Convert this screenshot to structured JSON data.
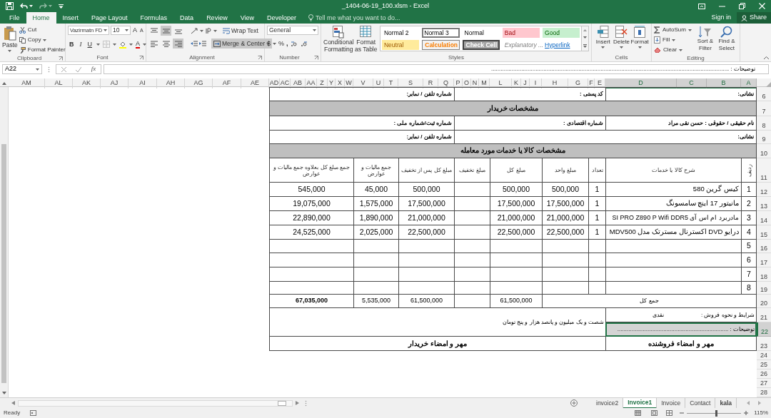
{
  "window": {
    "title": "_1404-06-19_100.xlsm - Excel"
  },
  "ribbon_tabs": [
    {
      "label": "File",
      "selected": false
    },
    {
      "label": "Home",
      "selected": true
    },
    {
      "label": "Insert",
      "selected": false
    },
    {
      "label": "Page Layout",
      "selected": false
    },
    {
      "label": "Formulas",
      "selected": false
    },
    {
      "label": "Data",
      "selected": false
    },
    {
      "label": "Review",
      "selected": false
    },
    {
      "label": "View",
      "selected": false
    },
    {
      "label": "Developer",
      "selected": false
    }
  ],
  "tell_me": {
    "placeholder": "Tell me what you want to do..."
  },
  "account": {
    "sign_in": "Sign in",
    "share": "Share"
  },
  "clipboard": {
    "paste": "Paste",
    "cut": "Cut",
    "copy": "Copy",
    "format_painter": "Format Painter",
    "label": "Clipboard"
  },
  "font": {
    "name": "Vazirmatn FD",
    "size": "10",
    "grow": "A",
    "shrink": "A",
    "bold": "B",
    "italic": "I",
    "underline": "U",
    "font_color": "A",
    "label": "Font"
  },
  "alignment": {
    "vertical": [
      {
        "selected": false
      },
      {
        "selected": true
      },
      {
        "selected": false
      }
    ],
    "horizontal": [
      {
        "selected": false
      },
      {
        "selected": false
      },
      {
        "selected": true
      }
    ],
    "wrap_text": "Wrap Text",
    "merge_center": {
      "label": "Merge & Center",
      "selected": true
    },
    "label": "Alignment"
  },
  "number": {
    "format": "General",
    "currency": "$",
    "percent": "%",
    "comma": ",",
    "label": "Number"
  },
  "styles": {
    "conditional_formatting": "Conditional Formatting",
    "format_as_table": "Format as Table",
    "gallery": [
      {
        "label": "Normal 2",
        "kind": "normal",
        "selected": false
      },
      {
        "label": "Normal 3",
        "kind": "normal",
        "selected": true
      },
      {
        "label": "Normal",
        "kind": "normal",
        "selected": false
      },
      {
        "label": "Bad",
        "kind": "bad",
        "selected": false
      },
      {
        "label": "Good",
        "kind": "good",
        "selected": false
      },
      {
        "label": "Neutral",
        "kind": "neutral",
        "selected": false
      },
      {
        "label": "Calculation",
        "kind": "calculation",
        "selected": false
      },
      {
        "label": "Check Cell",
        "kind": "check",
        "selected": false
      },
      {
        "label": "Explanatory ...",
        "kind": "explanatory",
        "selected": false
      },
      {
        "label": "Hyperlink",
        "kind": "hyperlink",
        "selected": false
      }
    ],
    "label": "Styles"
  },
  "cells": {
    "insert": "Insert",
    "delete": "Delete",
    "format": "Format",
    "label": "Cells"
  },
  "editing": {
    "autosum": "AutoSum",
    "fill": "Fill",
    "clear": "Clear",
    "sort_filter": "Sort & Filter",
    "find_select": "Find & Select",
    "label": "Editing"
  },
  "formula_bar": {
    "name_box": "A22",
    "function_label": "fx",
    "content": "توضیحات : ......................................................................................................................................................"
  },
  "sheet": {
    "columns": [
      {
        "label": "AM",
        "selected": false
      },
      {
        "label": "AL",
        "selected": false
      },
      {
        "label": "AK",
        "selected": false
      },
      {
        "label": "AJ",
        "selected": false
      },
      {
        "label": "AI",
        "selected": false
      },
      {
        "label": "AH",
        "selected": false
      },
      {
        "label": "AG",
        "selected": false
      },
      {
        "label": "AF",
        "selected": false
      },
      {
        "label": "AE",
        "selected": false
      },
      {
        "label": "AD",
        "selected": false
      },
      {
        "label": "AC",
        "selected": false
      },
      {
        "label": "AB",
        "selected": false
      },
      {
        "label": "AA",
        "selected": false
      },
      {
        "label": "Z",
        "selected": false
      },
      {
        "label": "Y",
        "selected": false
      },
      {
        "label": "X",
        "selected": false
      },
      {
        "label": "W",
        "selected": false
      },
      {
        "label": "V",
        "selected": false
      },
      {
        "label": "U",
        "selected": false
      },
      {
        "label": "T",
        "selected": false
      },
      {
        "label": "S",
        "selected": false
      },
      {
        "label": "R",
        "selected": false
      },
      {
        "label": "Q",
        "selected": false
      },
      {
        "label": "P",
        "selected": false
      },
      {
        "label": "O",
        "selected": false
      },
      {
        "label": "N",
        "selected": false
      },
      {
        "label": "M",
        "selected": false
      },
      {
        "label": "L",
        "selected": false
      },
      {
        "label": "K",
        "selected": false
      },
      {
        "label": "J",
        "selected": false
      },
      {
        "label": "I",
        "selected": false
      },
      {
        "label": "H",
        "selected": false
      },
      {
        "label": "G",
        "selected": false
      },
      {
        "label": "F",
        "selected": false
      },
      {
        "label": "E",
        "selected": false
      },
      {
        "label": "D",
        "selected": true
      },
      {
        "label": "C",
        "selected": true
      },
      {
        "label": "B",
        "selected": true
      },
      {
        "label": "A",
        "selected": true
      }
    ],
    "rows": [
      {
        "label": "6",
        "selected": false
      },
      {
        "label": "7",
        "selected": false
      },
      {
        "label": "8",
        "selected": false
      },
      {
        "label": "9",
        "selected": false
      },
      {
        "label": "10",
        "selected": false
      },
      {
        "label": "11",
        "selected": false
      },
      {
        "label": "12",
        "selected": false
      },
      {
        "label": "13",
        "selected": false
      },
      {
        "label": "14",
        "selected": false
      },
      {
        "label": "15",
        "selected": false
      },
      {
        "label": "16",
        "selected": false
      },
      {
        "label": "17",
        "selected": false
      },
      {
        "label": "18",
        "selected": false
      },
      {
        "label": "19",
        "selected": false
      },
      {
        "label": "20",
        "selected": false
      },
      {
        "label": "21",
        "selected": false
      },
      {
        "label": "22",
        "selected": true
      },
      {
        "label": "23",
        "selected": false
      },
      {
        "label": "24",
        "selected": false
      },
      {
        "label": "25",
        "selected": false
      },
      {
        "label": "26",
        "selected": false
      },
      {
        "label": "27",
        "selected": false
      },
      {
        "label": "28",
        "selected": false
      }
    ],
    "seller": {
      "address": "نشانی:",
      "postal_code": "کد پستی :",
      "phone": "شماره تلفن / نمابر:"
    },
    "buyer_heading": "مشخصات خریدار",
    "buyer": {
      "name": "نام حقیقی / حقوقی : حسن نقی مراد",
      "economic_code": "شماره اقتصادی :",
      "registration": "شماره ثبت/شماره ملی :",
      "address": "نشانی:",
      "phone": "شماره تلفن / نمابر:"
    },
    "items_heading": "مشخصات کالا یا خدمات مورد معامله",
    "item_columns": [
      "ردیف",
      "شرح کالا یا خدمات",
      "تعداد",
      "مبلغ واحد",
      "مبلغ کل",
      "مبلغ تخفیف",
      "مبلغ کل پس از تخفیف",
      "جمع مالیات و عوارض",
      "جمع مبلغ کل بعلاوه جمع مالیات و عوارض"
    ],
    "items": [
      {
        "index": "1",
        "description": "کیس گرین 580",
        "quantity": "1",
        "unit_price": "500,000",
        "total": "500,000",
        "total_after_discount": "500,000",
        "tax": "45,000",
        "grand_total": "545,000"
      },
      {
        "index": "2",
        "description": "مانیتور 17 اینچ سامسونگ",
        "quantity": "1",
        "unit_price": "17,500,000",
        "total": "17,500,000",
        "total_after_discount": "17,500,000",
        "tax": "1,575,000",
        "grand_total": "19,075,000"
      },
      {
        "index": "3",
        "description": "مادربرد ام اس آی SI PRO Z890 P Wifi DDR5",
        "quantity": "1",
        "unit_price": "21,000,000",
        "total": "21,000,000",
        "total_after_discount": "21,000,000",
        "tax": "1,890,000",
        "grand_total": "22,890,000"
      },
      {
        "index": "4",
        "description": "درایو DVD اکسترنال مسترتک مدل MDV500",
        "quantity": "1",
        "unit_price": "22,500,000",
        "total": "22,500,000",
        "total_after_discount": "22,500,000",
        "tax": "2,025,000",
        "grand_total": "24,525,000"
      },
      {
        "index": "5"
      },
      {
        "index": "6"
      },
      {
        "index": "7"
      },
      {
        "index": "8"
      }
    ],
    "totals": {
      "label": "جمع کل",
      "total": "61,500,000",
      "total_after_discount": "61,500,000",
      "tax": "5,535,000",
      "grand_total": "67,035,000"
    },
    "terms": {
      "label": "شرایط و نحوه فروش :",
      "value": "نقدی"
    },
    "amount_in_words": "شصت و یک میلیون و پانصد هزار و پنج تومان",
    "notes": {
      "text": "توضیحات : ......................................................................",
      "selected": true
    },
    "seller_signature": "مهر و امضاء فروشنده",
    "buyer_signature": "مهر و امضاء خریدار"
  },
  "sheet_tabs": [
    {
      "label": "invoice2",
      "selected": false,
      "bold": false
    },
    {
      "label": "Invoice1",
      "selected": true,
      "bold": false
    },
    {
      "label": "Invoice",
      "selected": false,
      "bold": false
    },
    {
      "label": "Contact",
      "selected": false,
      "bold": false
    },
    {
      "label": "kala",
      "selected": false,
      "bold": true
    }
  ],
  "status_bar": {
    "status": "Ready",
    "zoom": "115%",
    "zoom_slider": {
      "level": 0.55
    }
  }
}
